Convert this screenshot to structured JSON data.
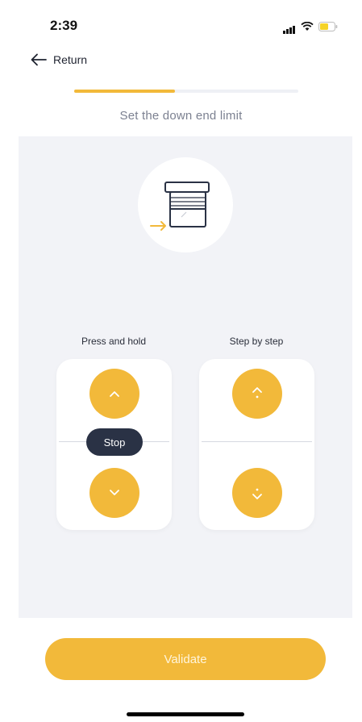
{
  "status_bar": {
    "time": "2:39"
  },
  "header": {
    "back_label": "Return",
    "progress": 0.45
  },
  "step": {
    "title": "Set the down end limit"
  },
  "press_hold": {
    "label": "Press and hold",
    "stop_label": "Stop"
  },
  "step_by_step": {
    "label": "Step by step"
  },
  "footer": {
    "validate_label": "Validate"
  },
  "colors": {
    "accent": "#f2b93a",
    "dark": "#2a3245",
    "panel": "#f2f3f7"
  }
}
